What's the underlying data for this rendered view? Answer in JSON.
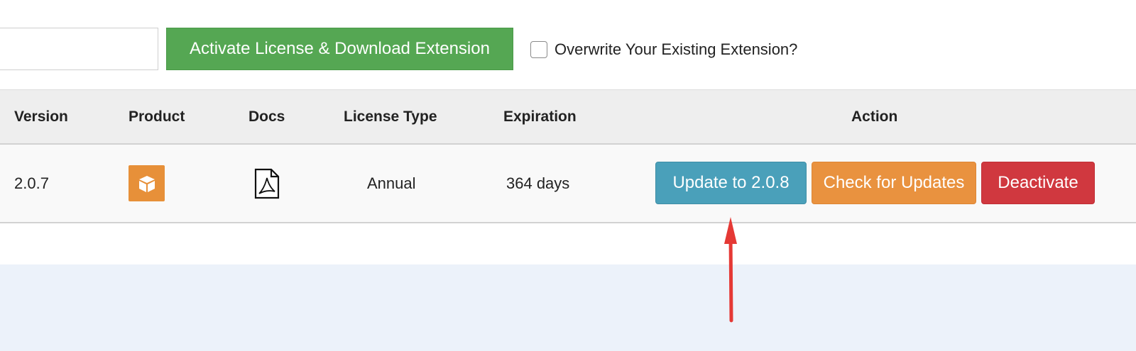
{
  "top_bar": {
    "license_input_value": "",
    "activate_button_label": "Activate License & Download Extension",
    "overwrite_checked": false,
    "overwrite_label": "Overwrite Your Existing Extension?"
  },
  "table": {
    "headers": {
      "version": "Version",
      "product": "Product",
      "docs": "Docs",
      "license_type": "License Type",
      "expiration": "Expiration",
      "action": "Action"
    },
    "rows": [
      {
        "version": "2.0.7",
        "product_icon": "box-icon",
        "docs_icon": "pdf-icon",
        "license_type": "Annual",
        "expiration": "364 days",
        "actions": {
          "update": "Update to 2.0.8",
          "check": "Check for Updates",
          "deactivate": "Deactivate"
        }
      }
    ]
  },
  "annotation": {
    "arrow_color": "#e53935",
    "arrow_target": "update-button"
  },
  "colors": {
    "activate_green": "#55a753",
    "update_blue": "#4aa0ba",
    "check_orange": "#e9923f",
    "deactivate_red": "#d0383f",
    "product_orange": "#e79039",
    "footer_blue": "#ecf2fa"
  }
}
